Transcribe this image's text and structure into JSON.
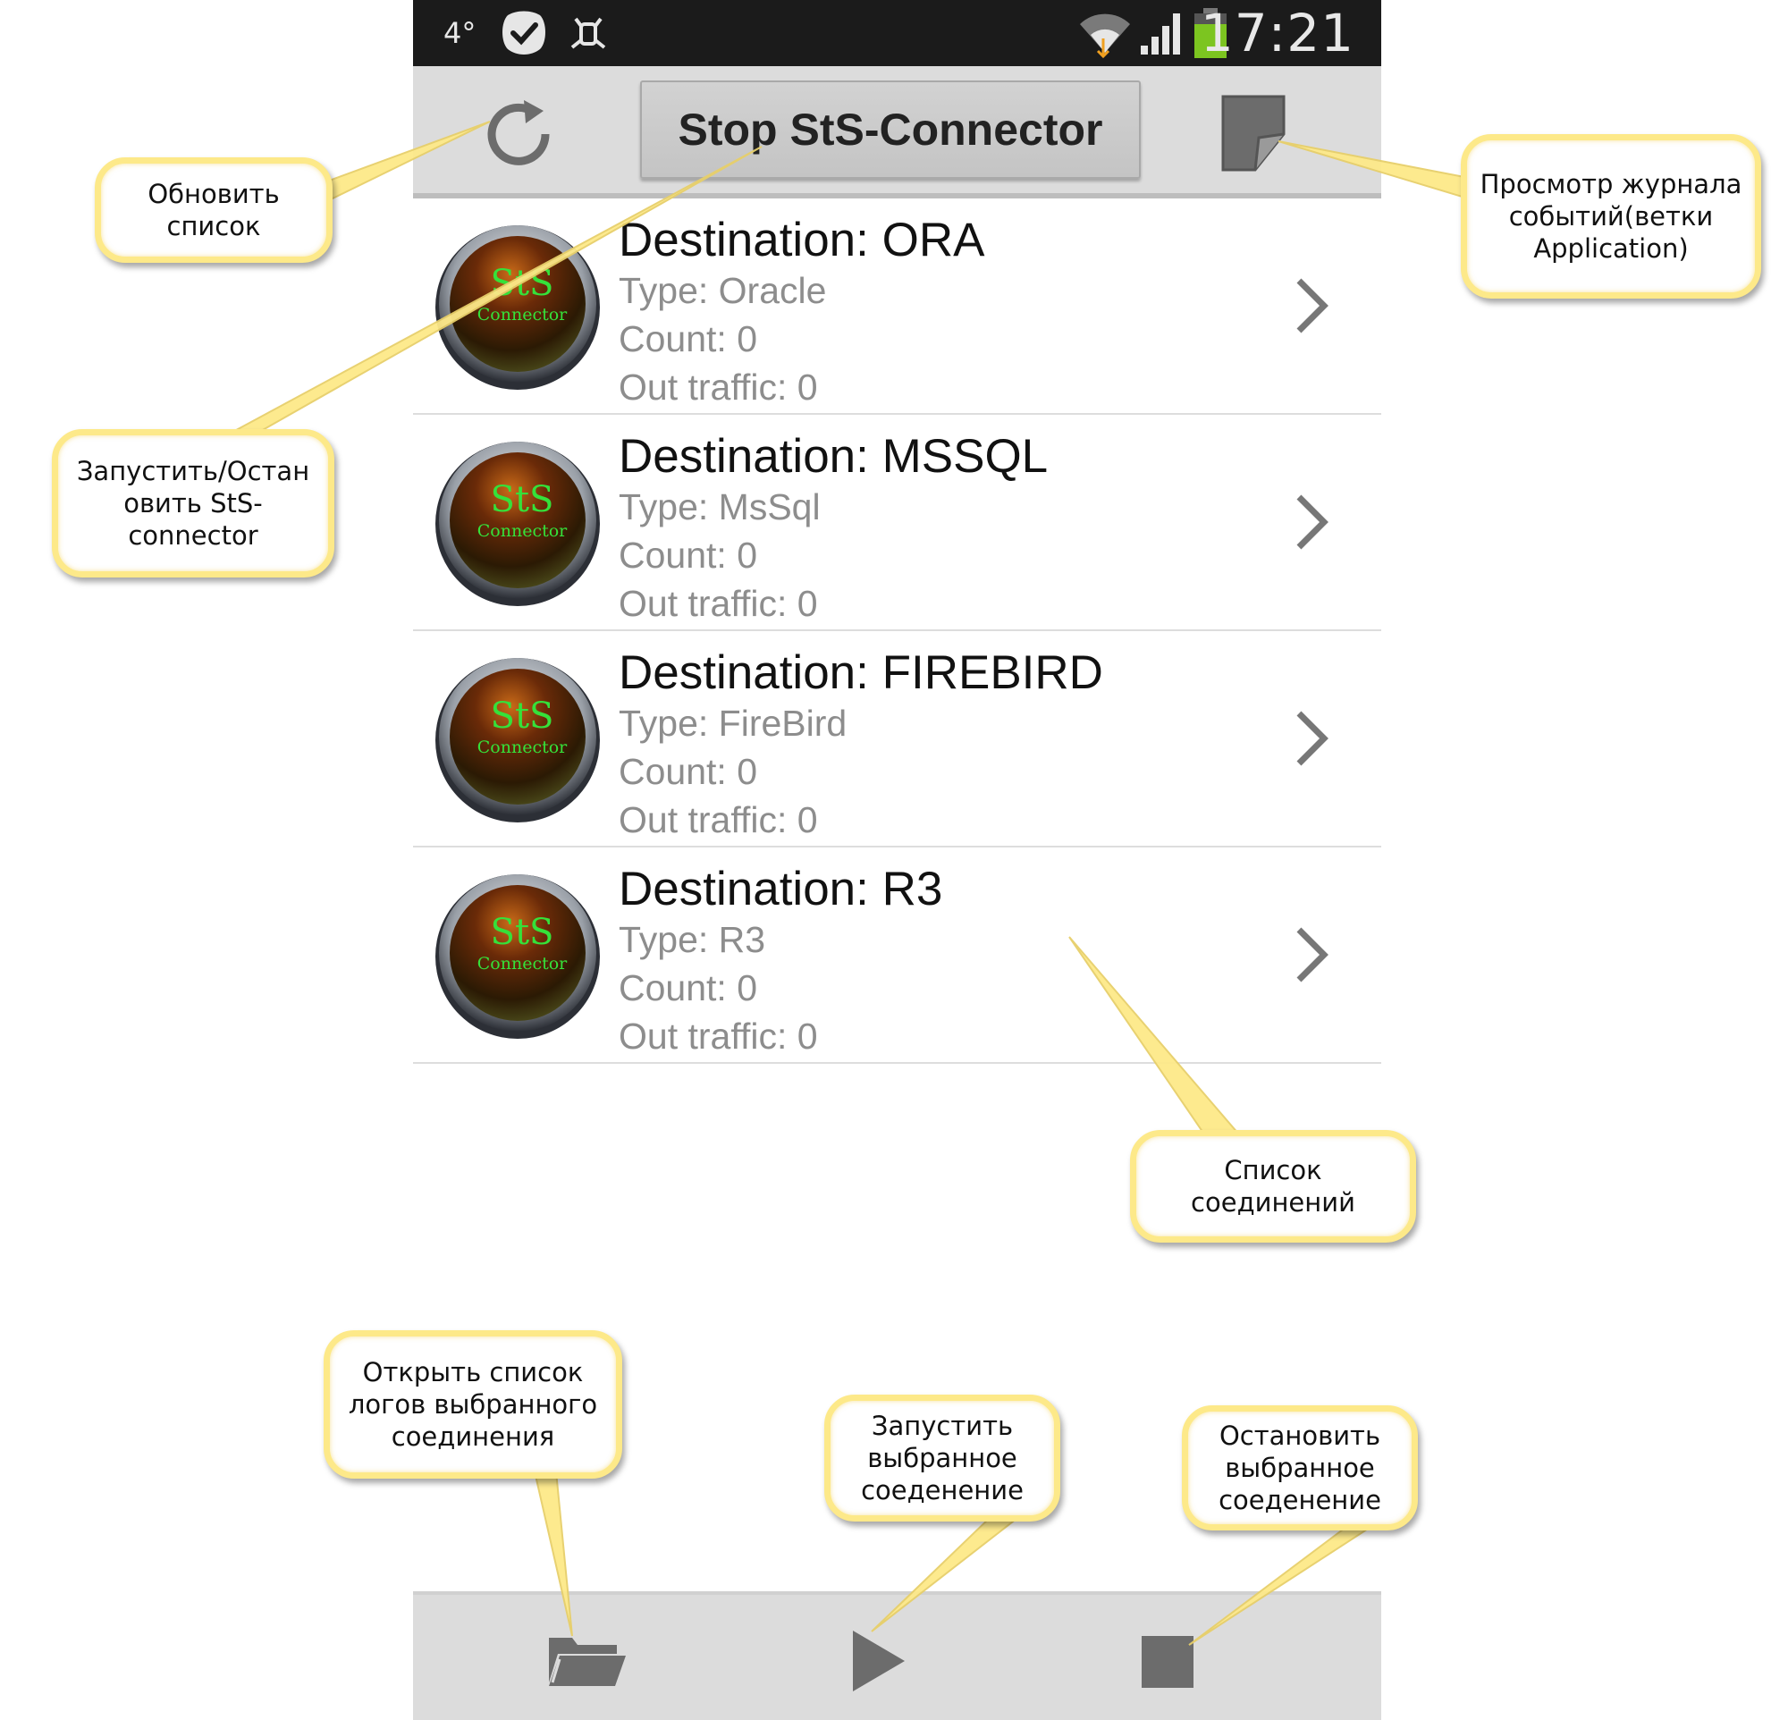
{
  "status_bar": {
    "temperature": "4°",
    "time": "17:21",
    "icons": [
      "check-icon",
      "usb-debug-icon",
      "wifi-icon",
      "signal-icon",
      "battery-icon"
    ]
  },
  "action_bar": {
    "refresh_icon": "refresh-icon",
    "main_button_label": "Stop StS-Connector",
    "log_icon": "event-log-icon"
  },
  "connections": [
    {
      "destination": "Destination: ORA",
      "type": "Type: Oracle",
      "count": "Count: 0",
      "traffic": "Out traffic: 0",
      "logo_text_1": "StS",
      "logo_text_2": "Connector"
    },
    {
      "destination": "Destination: MSSQL",
      "type": "Type: MsSql",
      "count": "Count: 0",
      "traffic": "Out traffic: 0",
      "logo_text_1": "StS",
      "logo_text_2": "Connector"
    },
    {
      "destination": "Destination: FIREBIRD",
      "type": "Type: FireBird",
      "count": "Count: 0",
      "traffic": "Out traffic: 0",
      "logo_text_1": "StS",
      "logo_text_2": "Connector"
    },
    {
      "destination": "Destination: R3",
      "type": "Type: R3",
      "count": "Count: 0",
      "traffic": "Out traffic: 0",
      "logo_text_1": "StS",
      "logo_text_2": "Connector"
    }
  ],
  "bottom_bar": {
    "icons": [
      "folder-open-icon",
      "play-icon",
      "stop-icon"
    ]
  },
  "callouts": {
    "refresh": [
      "Обновить",
      "список"
    ],
    "start_stop": [
      "Запустить/Остан",
      "овить StS-",
      "connector"
    ],
    "event_log": [
      "Просмотр журнала",
      "событий(ветки",
      "Application)"
    ],
    "connection_list": [
      "Список",
      "соединений"
    ],
    "open_logs": [
      "Открыть список",
      "логов  выбранного",
      "соединения"
    ],
    "start_selected": [
      "Запустить",
      "выбранное",
      "соеденение"
    ],
    "stop_selected": [
      "Остановить",
      "выбранное",
      "соеденение"
    ]
  },
  "colors": {
    "callout_border": "#fde989",
    "logo_text": "#35e13a",
    "action_bar": "#dcdcdc",
    "status_bar": "#1b1b1b",
    "battery": "#7cc520"
  }
}
